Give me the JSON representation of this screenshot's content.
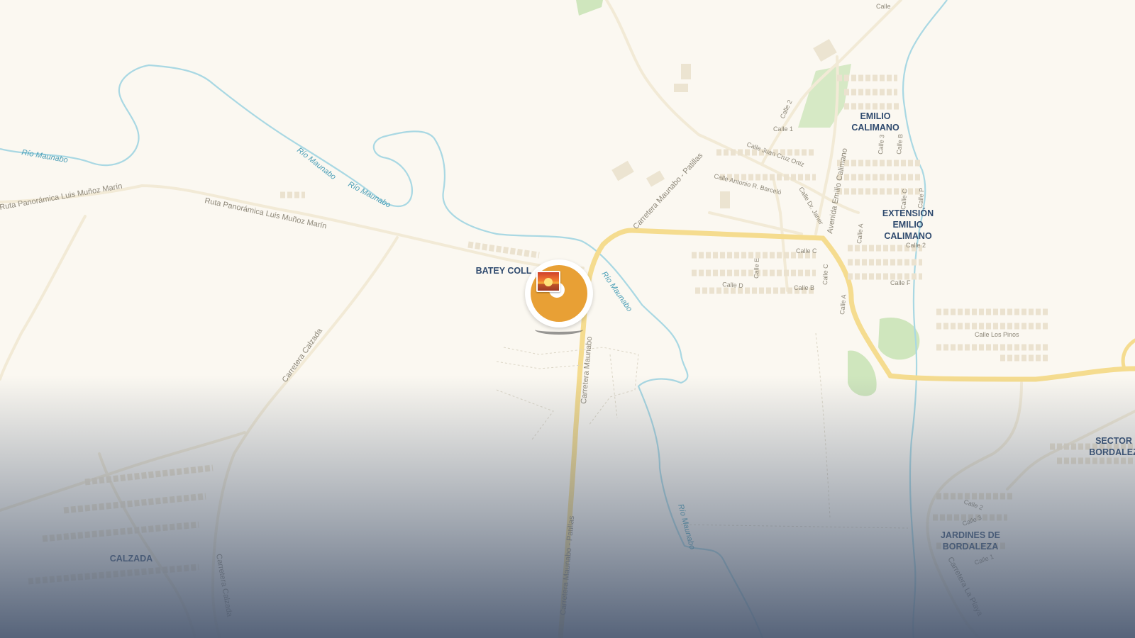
{
  "map": {
    "places": [
      {
        "name": "BATEY COLL"
      },
      {
        "name": "EMILIO\nCALIMANO"
      },
      {
        "name": "EXTENSIÓN\nEMILIO\nCALIMANO"
      },
      {
        "name": "SECTOR\nBORDALEZ"
      },
      {
        "name": "JARDINES DE\nBORDALEZA"
      },
      {
        "name": "CALZADA"
      }
    ],
    "roads": [
      "Ruta Panorámica Luis Muñoz Marín",
      "Ruta Panorámica Luis Muñoz Marín",
      "Carretera Calzada",
      "Carretera Calzada",
      "Carretera Maunabo - Patillas",
      "Carretera Maunabo - Patillas",
      "Carretera Maunabo",
      "Carretera La Playa",
      "Avenida Emilio Calimano"
    ],
    "streets": [
      "Calle 2",
      "Calle 1",
      "Calle Juan Cruz Ortiz",
      "Calle Antonio R. Barceló",
      "Calle Dr. Janer",
      "Calle 3",
      "Calle B",
      "Calle C",
      "Calle P",
      "Calle 2",
      "Calle A",
      "Calle E",
      "Calle C",
      "Calle C",
      "Calle D",
      "Calle B",
      "Calle F",
      "Calle A",
      "Calle Los Pinos",
      "Calle 2",
      "Calle 3",
      "Calle 1",
      "Calle"
    ],
    "rivers": [
      "Río Maunabo",
      "Río Maunabo",
      "Río Maunabo",
      "Río Maunabo",
      "Río Maunabo"
    ],
    "colors": {
      "land": "#fbf8f1",
      "major_road": "#f5dc8f",
      "minor_road": "#f2ead6",
      "water": "#a9d8e3",
      "park": "#cfe6bd",
      "place_label": "#2f4a6e",
      "water_label": "#4c9fb7",
      "marker_fill": "#e8a035",
      "fade": "#5a687e"
    }
  },
  "marker": {
    "icon": "sunset-photo-icon"
  }
}
